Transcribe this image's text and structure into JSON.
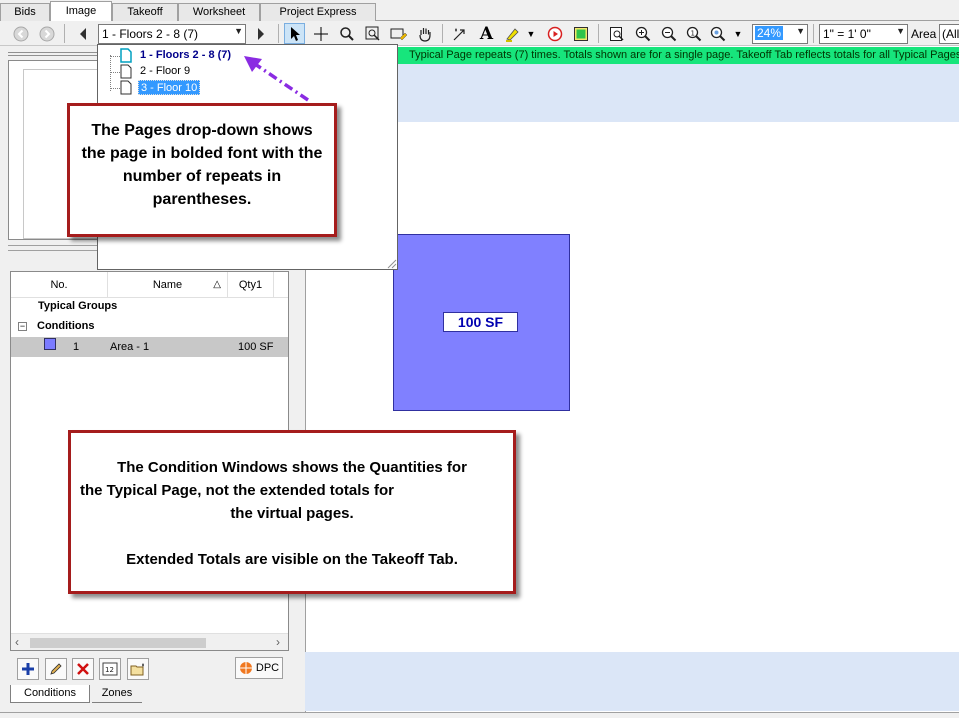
{
  "tabs": [
    {
      "label": "Bids",
      "active": false
    },
    {
      "label": "Image",
      "active": true
    },
    {
      "label": "Takeoff",
      "active": false
    },
    {
      "label": "Worksheet",
      "active": false
    },
    {
      "label": "Project Express",
      "active": false
    }
  ],
  "toolbar": {
    "page_select_value": "1 - Floors 2 - 8 (7)",
    "zoom_value": "24%",
    "scale_value": "1\" = 1' 0\"",
    "area_label": "Area",
    "area_select_value": "(All"
  },
  "pages_dropdown": {
    "items": [
      {
        "label": "1 - Floors 2 - 8 (7)",
        "bold": true,
        "selected": false
      },
      {
        "label": "2 - Floor 9",
        "bold": false,
        "selected": false
      },
      {
        "label": "3 - Floor 10",
        "bold": false,
        "selected": true
      }
    ]
  },
  "info_bar": {
    "text": "Typical Page repeats (7) times. Totals shown are for a single page. Takeoff Tab reflects totals for all Typical Pages.",
    "color": "#17e57c"
  },
  "conditions_grid": {
    "columns": [
      "No.",
      "Name",
      "Qty1"
    ],
    "groups": [
      {
        "label": "Typical Groups"
      },
      {
        "label": "Conditions",
        "expander": "−"
      }
    ],
    "rows": [
      {
        "no": "1",
        "name": "Area - 1",
        "qty1": "100 SF",
        "color": "#7b7bff"
      }
    ]
  },
  "canvas": {
    "area_label": "100 SF",
    "shape_color": "#8080ff"
  },
  "callouts": {
    "pages": "The Pages drop-down shows the page in bolded font with the number of repeats in parentheses.",
    "conditions_line1": "The Condition Windows shows the Quantities for",
    "conditions_line2": "the Typical Page, not the extended totals for",
    "conditions_line3": "the virtual pages.",
    "conditions_line4": "Extended Totals are visible on the Takeoff Tab."
  },
  "bottom_toolbar": {
    "dpc_label": "DPC"
  },
  "bottom_tabs": [
    {
      "label": "Conditions",
      "active": true
    },
    {
      "label": "Zones",
      "active": false
    }
  ]
}
